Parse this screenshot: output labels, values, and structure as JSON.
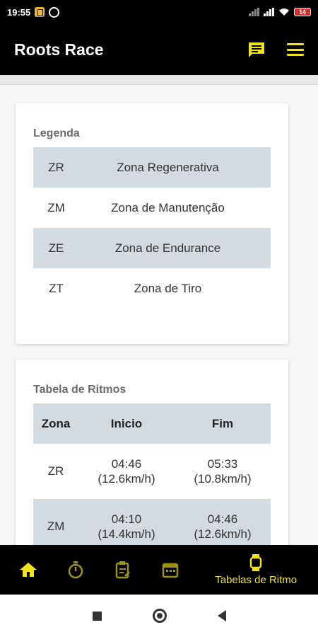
{
  "status_bar": {
    "time": "19:55",
    "battery": "14"
  },
  "app_bar": {
    "title": "Roots Race",
    "icons": [
      "chat-icon",
      "menu-icon"
    ],
    "accent": "#f0e31a"
  },
  "legend": {
    "title": "Legenda",
    "rows": [
      {
        "abbr": "ZR",
        "name": "Zona Regenerativa"
      },
      {
        "abbr": "ZM",
        "name": "Zona de Manutenção"
      },
      {
        "abbr": "ZE",
        "name": "Zona de Endurance"
      },
      {
        "abbr": "ZT",
        "name": "Zona de Tiro"
      }
    ]
  },
  "rates": {
    "title": "Tabela de Ritmos",
    "headers": {
      "zone": "Zona",
      "start": "Inicio",
      "end": "Fim"
    },
    "rows": [
      {
        "zone": "ZR",
        "start_pace": "04:46",
        "start_speed": "(12.6km/h)",
        "end_pace": "05:33",
        "end_speed": "(10.8km/h)"
      },
      {
        "zone": "ZM",
        "start_pace": "04:10",
        "start_speed": "(14.4km/h)",
        "end_pace": "04:46",
        "end_speed": "(12.6km/h)"
      }
    ]
  },
  "bottom_nav": {
    "items": [
      {
        "icon": "home-icon"
      },
      {
        "icon": "stopwatch-icon"
      },
      {
        "icon": "clipboard-icon"
      },
      {
        "icon": "calendar-icon"
      },
      {
        "icon": "watch-icon",
        "label": "Tabelas de Ritmo"
      }
    ]
  },
  "colors": {
    "bar_background": "#000000",
    "accent_yellow": "#f0e31a",
    "row_shade": "#d3dbe0"
  }
}
